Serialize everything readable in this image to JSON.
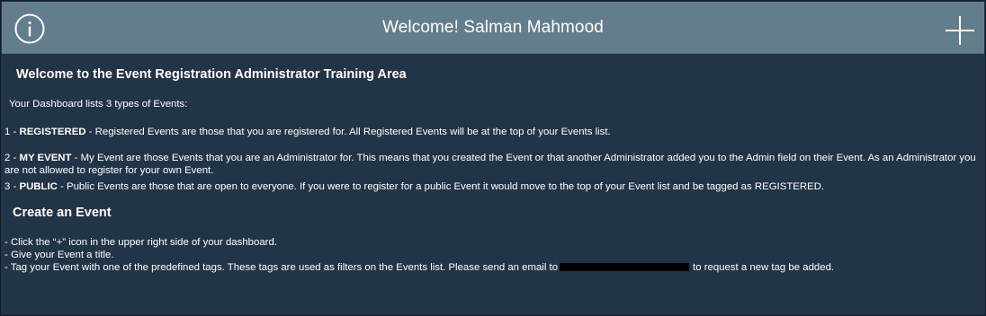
{
  "header": {
    "title": "Welcome! Salman Mahmood",
    "info_icon": "info-circle-icon",
    "add_icon": "plus-icon",
    "background": "#647d8d"
  },
  "main": {
    "background": "#223547",
    "heading": "Welcome to the Event Registration Administrator Training Area",
    "intro": "Your Dashboard lists 3 types of Events:",
    "types": [
      {
        "prefix": "1 - ",
        "term": "REGISTERED",
        "text": " - Registered Events are those that you are registered for. All Registered Events will be at the top of your Events list."
      },
      {
        "prefix": "2 - ",
        "term": "MY EVENT",
        "text": " - My Event are those Events that you are an Administrator for. This means that you created the Event or that another Administrator added you to the Admin field on their Event. As an Administrator you are not allowed to register for your own Event."
      },
      {
        "prefix": "3 - ",
        "term": "PUBLIC",
        "text": " - Public Events are those that are open to everyone. If you were to register for a public Event it would move to the top of your Event list and be tagged as REGISTERED."
      }
    ],
    "create_heading": "Create an Event",
    "steps": [
      "- Click the “+” icon in the upper right side of your dashboard.",
      "- Give your Event a title."
    ],
    "tag_step_before": "- Tag your Event with one of the predefined tags. These tags are used as filters on the Events list. Please send an email to",
    "tag_step_after": "to request a new tag be added."
  }
}
